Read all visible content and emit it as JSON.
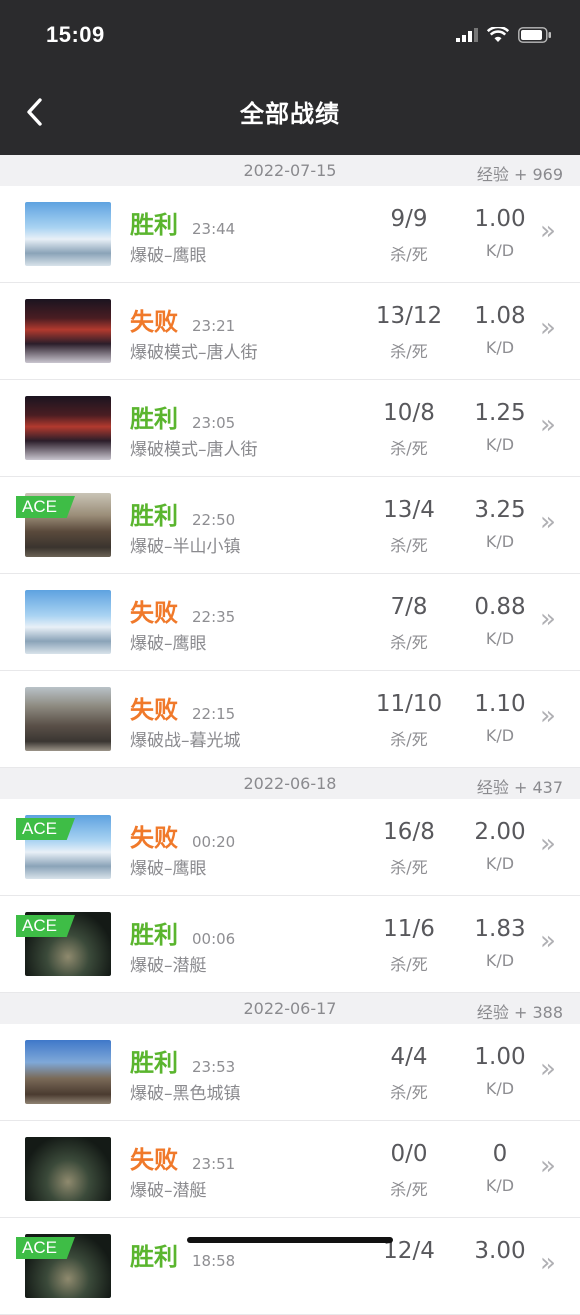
{
  "status": {
    "time": "15:09"
  },
  "nav": {
    "title": "全部战绩"
  },
  "sections": [
    {
      "date": "2022-07-15",
      "exp": "经验 + 969",
      "rows": [
        {
          "result": "胜利",
          "win": true,
          "time": "23:44",
          "mode": "爆破–鹰眼",
          "kd": "9/9",
          "kd_label": "杀/死",
          "ratio": "1.00",
          "ratio_label": "K/D",
          "ace": false,
          "thumb": "snow"
        },
        {
          "result": "失败",
          "win": false,
          "time": "23:21",
          "mode": "爆破模式–唐人街",
          "kd": "13/12",
          "kd_label": "杀/死",
          "ratio": "1.08",
          "ratio_label": "K/D",
          "ace": false,
          "thumb": "china"
        },
        {
          "result": "胜利",
          "win": true,
          "time": "23:05",
          "mode": "爆破模式–唐人街",
          "kd": "10/8",
          "kd_label": "杀/死",
          "ratio": "1.25",
          "ratio_label": "K/D",
          "ace": false,
          "thumb": "china"
        },
        {
          "result": "胜利",
          "win": true,
          "time": "22:50",
          "mode": "爆破–半山小镇",
          "kd": "13/4",
          "kd_label": "杀/死",
          "ratio": "3.25",
          "ratio_label": "K/D",
          "ace": true,
          "thumb": "village"
        },
        {
          "result": "失败",
          "win": false,
          "time": "22:35",
          "mode": "爆破–鹰眼",
          "kd": "7/8",
          "kd_label": "杀/死",
          "ratio": "0.88",
          "ratio_label": "K/D",
          "ace": false,
          "thumb": "snow"
        },
        {
          "result": "失败",
          "win": false,
          "time": "22:15",
          "mode": "爆破战–暮光城",
          "kd": "11/10",
          "kd_label": "杀/死",
          "ratio": "1.10",
          "ratio_label": "K/D",
          "ace": false,
          "thumb": "twilight"
        }
      ]
    },
    {
      "date": "2022-06-18",
      "exp": "经验 + 437",
      "rows": [
        {
          "result": "失败",
          "win": false,
          "time": "00:20",
          "mode": "爆破–鹰眼",
          "kd": "16/8",
          "kd_label": "杀/死",
          "ratio": "2.00",
          "ratio_label": "K/D",
          "ace": true,
          "thumb": "snow"
        },
        {
          "result": "胜利",
          "win": true,
          "time": "00:06",
          "mode": "爆破–潜艇",
          "kd": "11/6",
          "kd_label": "杀/死",
          "ratio": "1.83",
          "ratio_label": "K/D",
          "ace": true,
          "thumb": "sub"
        }
      ]
    },
    {
      "date": "2022-06-17",
      "exp": "经验 + 388",
      "rows": [
        {
          "result": "胜利",
          "win": true,
          "time": "23:53",
          "mode": "爆破–黑色城镇",
          "kd": "4/4",
          "kd_label": "杀/死",
          "ratio": "1.00",
          "ratio_label": "K/D",
          "ace": false,
          "thumb": "town"
        },
        {
          "result": "失败",
          "win": false,
          "time": "23:51",
          "mode": "爆破–潜艇",
          "kd": "0/0",
          "kd_label": "杀/死",
          "ratio": "0",
          "ratio_label": "K/D",
          "ace": false,
          "thumb": "sub"
        },
        {
          "result": "胜利",
          "win": true,
          "time": "18:58",
          "mode": "",
          "kd": "12/4",
          "kd_label": "",
          "ratio": "3.00",
          "ratio_label": "",
          "ace": true,
          "thumb": "sub"
        }
      ]
    }
  ],
  "ace_label": "ACE",
  "colors": {
    "win": "#5ab52e",
    "lose": "#f0792a",
    "ace": "#3ebd46",
    "header_bg": "#2b2b2d"
  },
  "icons": {
    "back": "chevron-left-icon",
    "row_arrow": "double-chevron-right-icon"
  }
}
